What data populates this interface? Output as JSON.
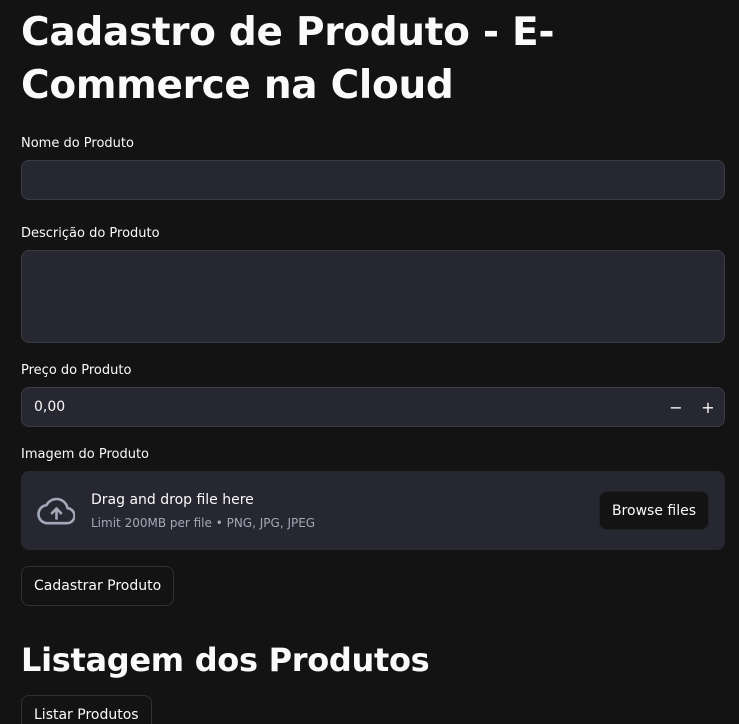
{
  "page": {
    "title": "Cadastro de Produto - E-Commerce na Cloud"
  },
  "form": {
    "name_label": "Nome do Produto",
    "name_value": "",
    "description_label": "Descrição do Produto",
    "description_value": "",
    "price_label": "Preço do Produto",
    "price_value": "0,00",
    "price_decrement": "−",
    "price_increment": "+",
    "image_label": "Imagem do Produto",
    "dropzone_title": "Drag and drop file here",
    "dropzone_limit": "Limit 200MB per file • PNG, JPG, JPEG",
    "browse_label": "Browse files",
    "upload_icon": "cloud-upload-icon",
    "submit_label": "Cadastrar Produto"
  },
  "listing": {
    "title": "Listagem dos Produtos",
    "list_label": "Listar Produtos"
  },
  "colors": {
    "background": "#131314",
    "input_bg": "#262730",
    "text": "#fafafa",
    "muted": "#a3a8b8"
  }
}
